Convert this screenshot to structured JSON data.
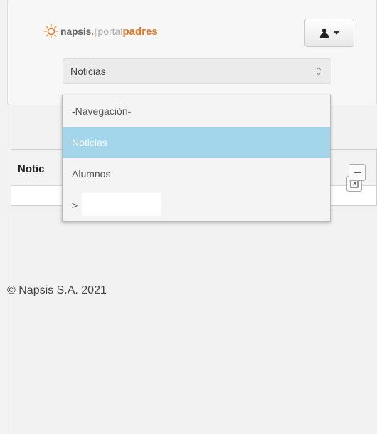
{
  "header": {
    "logo": {
      "brand": "napsis",
      "dot": ".",
      "separator": "|",
      "portal": "portal",
      "product": "padres"
    },
    "user_menu": {
      "icon": "user-icon",
      "caret": "caret-down-icon"
    }
  },
  "navigation": {
    "selected_value": "Noticias",
    "options": [
      {
        "label": "-Navegación-",
        "selected": false
      },
      {
        "label": "Noticias",
        "selected": true
      },
      {
        "label": "Alumnos",
        "selected": false
      },
      {
        "label": ">",
        "selected": false
      }
    ]
  },
  "panel": {
    "title": "Notic",
    "tools": [
      "expand-icon",
      "collapse-icon"
    ]
  },
  "footer": {
    "copyright": "© Napsis S.A. 2021"
  },
  "colors": {
    "brand_orange": "#e87722",
    "selected_option": "#a3d6ea",
    "page_background": "#f2f2f2"
  }
}
